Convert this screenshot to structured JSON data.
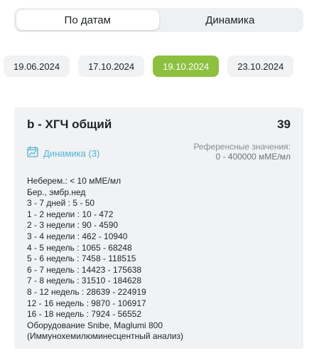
{
  "tabs": [
    {
      "label": "По датам",
      "active": true
    },
    {
      "label": "Динамика",
      "active": false
    }
  ],
  "dates": [
    {
      "label": "19.06.2024",
      "active": false
    },
    {
      "label": "17.10.2024",
      "active": false
    },
    {
      "label": "19.10.2024",
      "active": true
    },
    {
      "label": "23.10.2024",
      "active": false
    }
  ],
  "colors": {
    "accent": "#8dc03f",
    "link": "#4fb3d8",
    "card_bg": "#f1f2f3"
  },
  "card": {
    "title": "b - ХГЧ общий",
    "value": "39",
    "dynamics_icon": "chart-icon",
    "dynamics_label": "Динамика (3)",
    "reference_label": "Референсные значения:",
    "reference_value": "0 - 400000 мМЕ/мл",
    "notes": [
      "Неберем.: < 10 мМЕ/мл",
      "Бер., эмбр.нед",
      "3 - 7 дней : 5 - 50",
      "1 - 2 недели : 10 - 472",
      "2 - 3 недели : 90 - 4590",
      "3 - 4 недели : 462 - 10940",
      "4 - 5 недель : 1065 - 68248",
      "5 - 6 недель : 7458 - 118515",
      "6 - 7 недель : 14423 - 175638",
      "7 - 8 недель : 31510 - 184628",
      "8 - 12 недель : 28639 - 224919",
      "12 - 16 недель : 9870 - 106917",
      "16 - 18 недель : 7924 - 56552",
      "Оборудование Snibe, Maglumi 800",
      "(Иммунохемилюминесцентный анализ)"
    ]
  }
}
